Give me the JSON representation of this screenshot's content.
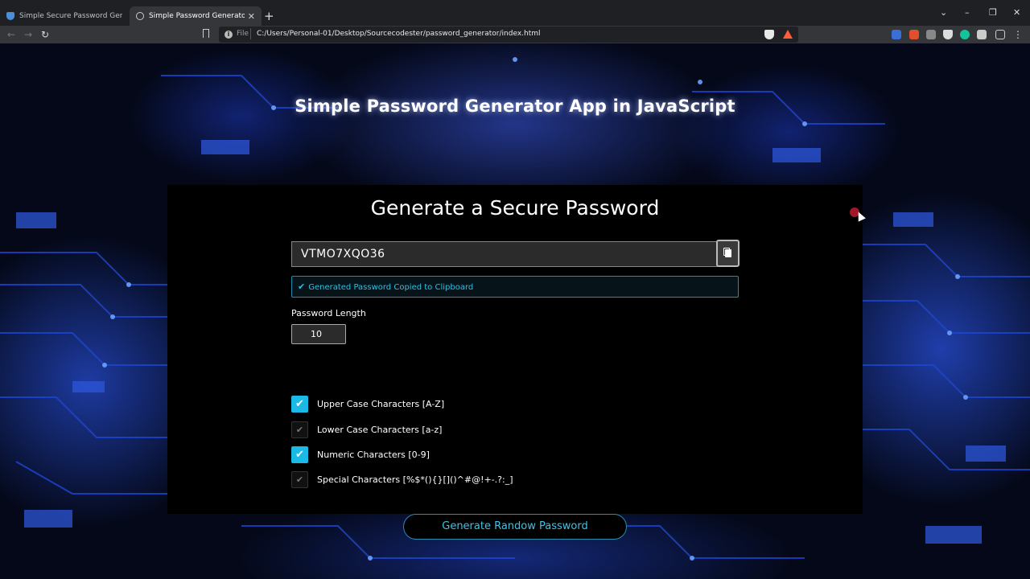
{
  "browser": {
    "tabs": [
      {
        "title": "Simple Secure Password Generator us",
        "active": false
      },
      {
        "title": "Simple Password Generator App",
        "active": true
      }
    ],
    "new_tab": "+",
    "window_controls": {
      "chevron": "⌄",
      "minimize": "–",
      "restore": "❐",
      "close": "✕"
    },
    "nav": {
      "back": "←",
      "forward": "→",
      "reload": "↻"
    },
    "address": {
      "scheme_label": "File",
      "url": "C:/Users/Personal-01/Desktop/Sourcecodester/password_generator/index.html"
    },
    "icons": [
      "bookmark-icon",
      "info-icon",
      "brave-shields-icon",
      "brave-rewards-icon",
      "translate-icon",
      "extension-icons",
      "menu-icon"
    ],
    "menu": "⋮"
  },
  "page": {
    "heading": "Simple Password Generator App in JavaScript",
    "card_title": "Generate a Secure Password",
    "password_value": "VTMO7XQO36",
    "copy_alert": "Generated Password Copied to Clipboard",
    "length_label": "Password Length",
    "length_value": "10",
    "options": [
      {
        "label": "Upper Case Characters [A-Z]",
        "checked": true
      },
      {
        "label": "Lower Case Characters [a-z]",
        "checked": false
      },
      {
        "label": "Numeric Characters [0-9]",
        "checked": true
      },
      {
        "label": "Special Characters [%$*(){}[]()^#@!+-.?:_]",
        "checked": false
      }
    ],
    "generate_button": "Generate Randow Password",
    "check_mark": "✔"
  },
  "colors": {
    "accent": "#1ab9e6",
    "card_bg": "#000000",
    "chrome_bg": "#35363a",
    "alert_text": "#2cc0e3"
  }
}
